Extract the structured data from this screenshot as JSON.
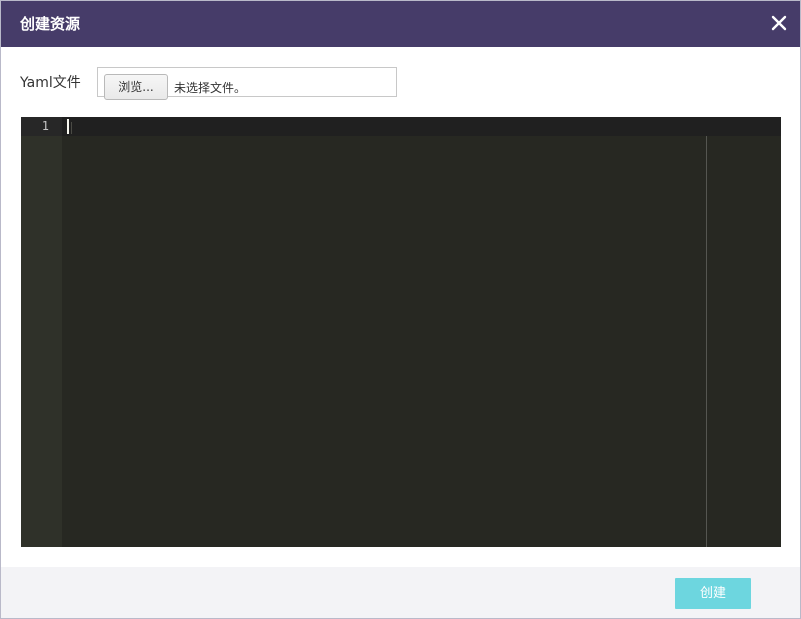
{
  "dialog": {
    "title": "创建资源",
    "close_icon": "close-icon"
  },
  "file_input": {
    "label": "Yaml文件",
    "browse_label": "浏览...",
    "status": "未选择文件。"
  },
  "editor": {
    "line_numbers": [
      "1"
    ],
    "content": "",
    "theme": {
      "background": "#272822",
      "gutter": "#2f3129",
      "active_line": "#202020"
    }
  },
  "footer": {
    "create_label": "创建"
  },
  "colors": {
    "header": "#463c69",
    "primary_button": "#6dd6df",
    "footer_bg": "#f3f3f6"
  }
}
